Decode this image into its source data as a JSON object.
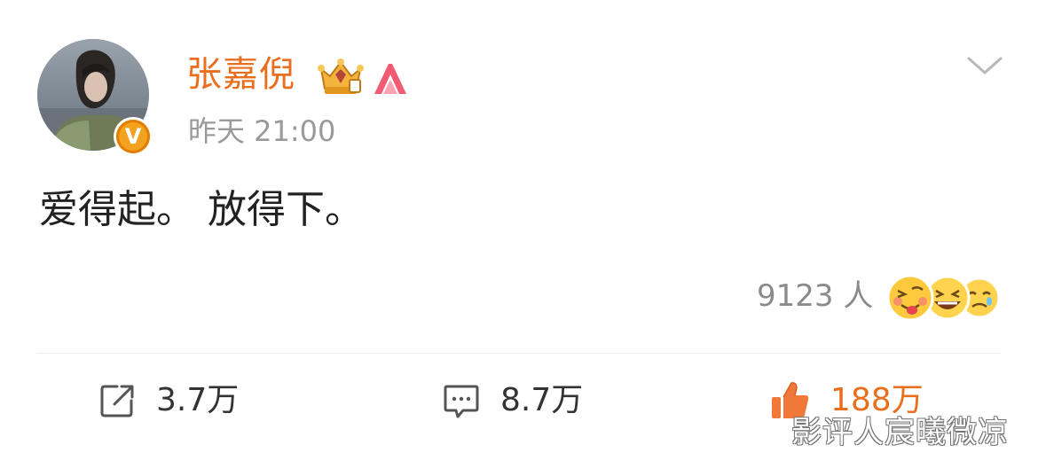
{
  "post": {
    "author": {
      "name": "张嘉倪",
      "verified_badge": "V",
      "badge_icons": [
        "crown-vip-icon",
        "level-icon"
      ],
      "name_color": "#e96f1f"
    },
    "timestamp": "昨天 21:00",
    "content": "爱得起。 放得下。",
    "reactions": {
      "count": "9123 人",
      "emojis": [
        "tongue-face-emoji",
        "laughing-face-emoji",
        "crying-face-emoji"
      ]
    },
    "actions": {
      "repost": {
        "icon": "repost-icon",
        "count": "3.7万"
      },
      "comment": {
        "icon": "comment-icon",
        "count": "8.7万"
      },
      "like": {
        "icon": "thumbs-up-icon",
        "count": "188万",
        "active_color": "#e96f1f"
      }
    }
  },
  "watermark": "影评人宸曦微凉"
}
